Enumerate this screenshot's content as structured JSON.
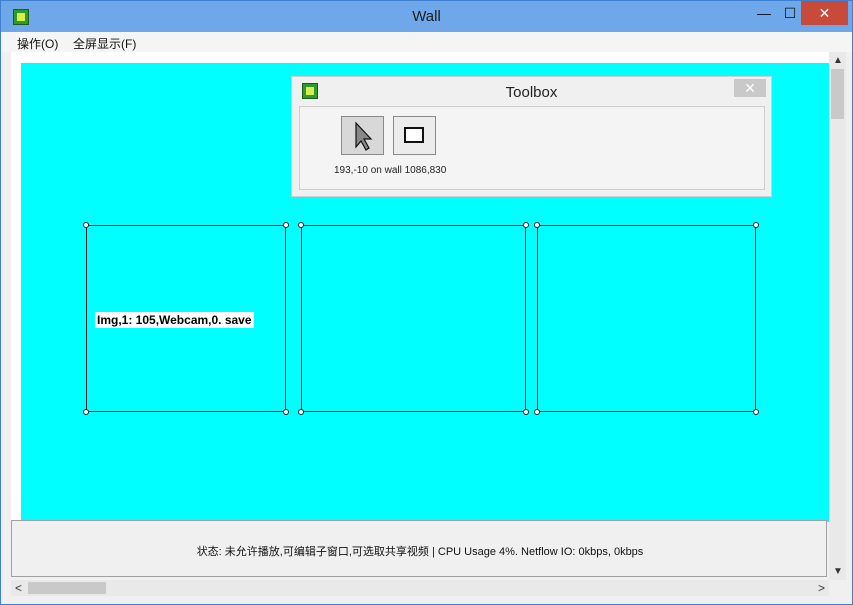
{
  "window": {
    "title": "Wall",
    "minimize_glyph": "—",
    "maximize_glyph": "☐",
    "close_glyph": "✕"
  },
  "menu": {
    "items": [
      "操作(O)",
      "全屏显示(F)"
    ]
  },
  "toolbox": {
    "title": "Toolbox",
    "close_glyph": "✕",
    "tools": [
      {
        "name": "select-arrow-tool",
        "icon": "arrow-pointer-icon"
      },
      {
        "name": "rectangle-tool",
        "icon": "rectangle-icon"
      }
    ],
    "coords_text": "193,-10 on wall 1086,830"
  },
  "wall": {
    "background_color": "#00ffff",
    "windows": [
      {
        "label": "Img,1: 105,Webcam,0. save"
      },
      {
        "label": ""
      },
      {
        "label": ""
      }
    ]
  },
  "status": {
    "text": "状态: 未允许播放,可编辑子窗口,可选取共享视频 | CPU Usage 4%. Netflow IO: 0kbps, 0kbps"
  },
  "scrollbars": {
    "up_glyph": "▲",
    "down_glyph": "▼",
    "left_glyph": "<",
    "right_glyph": ">"
  }
}
